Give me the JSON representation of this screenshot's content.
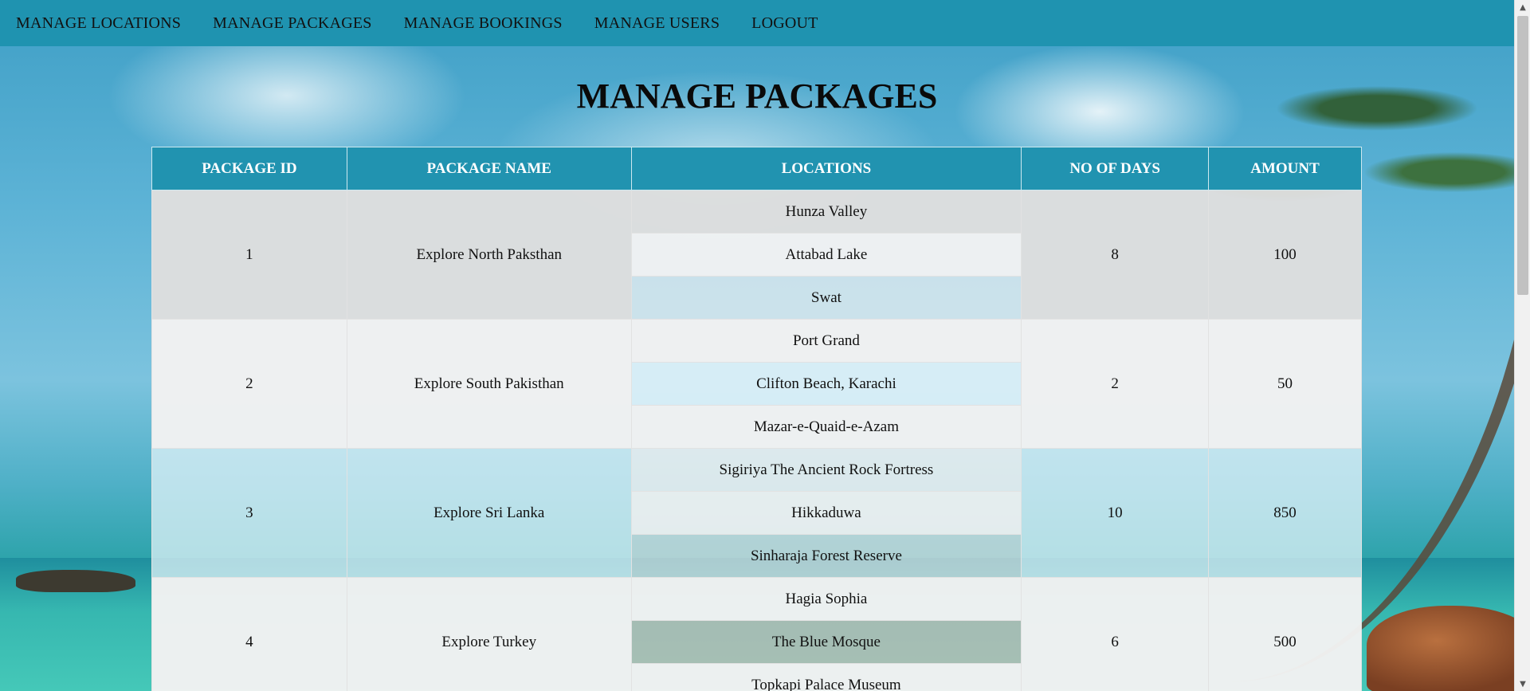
{
  "nav": {
    "items": [
      "MANAGE LOCATIONS",
      "MANAGE PACKAGES",
      "MANAGE BOOKINGS",
      "MANAGE USERS",
      "LOGOUT"
    ]
  },
  "page": {
    "title": "MANAGE PACKAGES"
  },
  "table": {
    "headers": [
      "PACKAGE ID",
      "PACKAGE NAME",
      "LOCATIONS",
      "NO OF DAYS",
      "AMOUNT"
    ],
    "rows": [
      {
        "id": "1",
        "name": "Explore North Paksthan",
        "locations": [
          "Hunza Valley",
          "Attabad Lake",
          "Swat"
        ],
        "days": "8",
        "amount": "100"
      },
      {
        "id": "2",
        "name": "Explore South Pakisthan",
        "locations": [
          "Port Grand",
          "Clifton Beach, Karachi",
          "Mazar-e-Quaid-e-Azam"
        ],
        "days": "2",
        "amount": "50"
      },
      {
        "id": "3",
        "name": "Explore Sri Lanka",
        "locations": [
          "Sigiriya The Ancient Rock Fortress",
          "Hikkaduwa",
          "Sinharaja Forest Reserve"
        ],
        "days": "10",
        "amount": "850"
      },
      {
        "id": "4",
        "name": "Explore Turkey",
        "locations": [
          "Hagia Sophia",
          "The Blue Mosque",
          "Topkapi Palace Museum"
        ],
        "days": "6",
        "amount": "500"
      }
    ]
  },
  "colors": {
    "nav_bg": "#1f93b0",
    "header_bg": "#2193b0"
  },
  "icons": {
    "scroll_up": "▲",
    "scroll_down": "▼"
  }
}
